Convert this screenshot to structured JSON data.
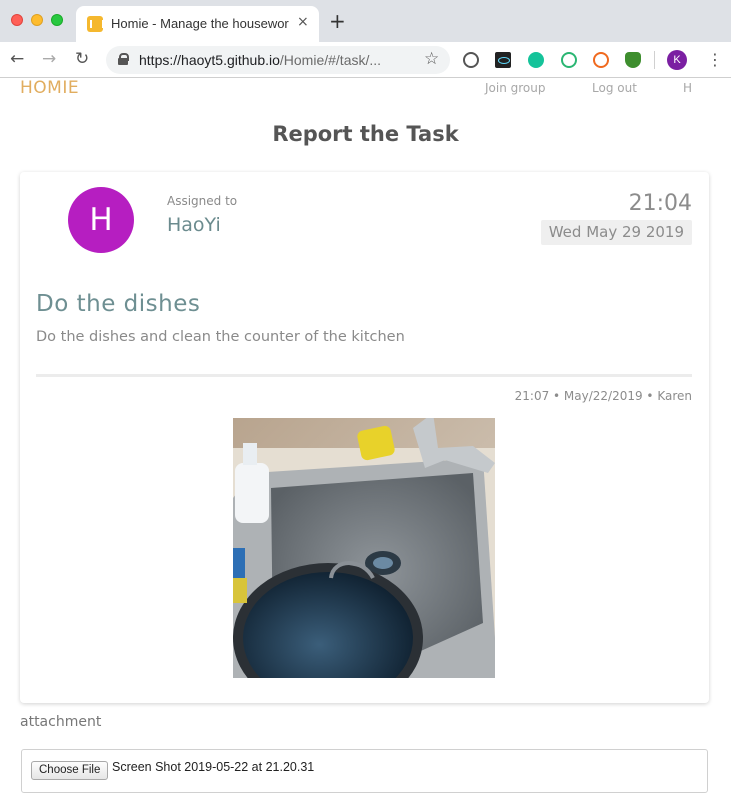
{
  "browser": {
    "tab_title": "Homie - Manage the housework",
    "tab_close": "×",
    "new_tab": "+",
    "url_prefix": "https://",
    "url_host": "haoyt5.github.io",
    "url_path": "/Homie/#/task/...",
    "profile_initial": "K"
  },
  "app": {
    "brand": "HOMIE",
    "nav": {
      "join_group": "Join group",
      "log_out": "Log out",
      "user_initial": "H"
    },
    "page_title": "Report the Task"
  },
  "task": {
    "avatar_initial": "H",
    "avatar_color": "#b61ec1",
    "assigned_label": "Assigned to",
    "assignee": "HaoYi",
    "time": "21:04",
    "date": "Wed May 29 2019",
    "title": "Do the dishes",
    "description": "Do the dishes and clean the counter of the kitchen"
  },
  "report": {
    "meta": "21:07 • May/22/2019 • Karen",
    "photo_icon": "kitchen-sink-photo"
  },
  "attachment": {
    "label": "attachment",
    "button": "Choose File",
    "file_name": "Screen Shot 2019-05-22 at 21.20.31"
  },
  "colors": {
    "brand": "#e1ad5f",
    "title_teal": "#6e8f92"
  }
}
